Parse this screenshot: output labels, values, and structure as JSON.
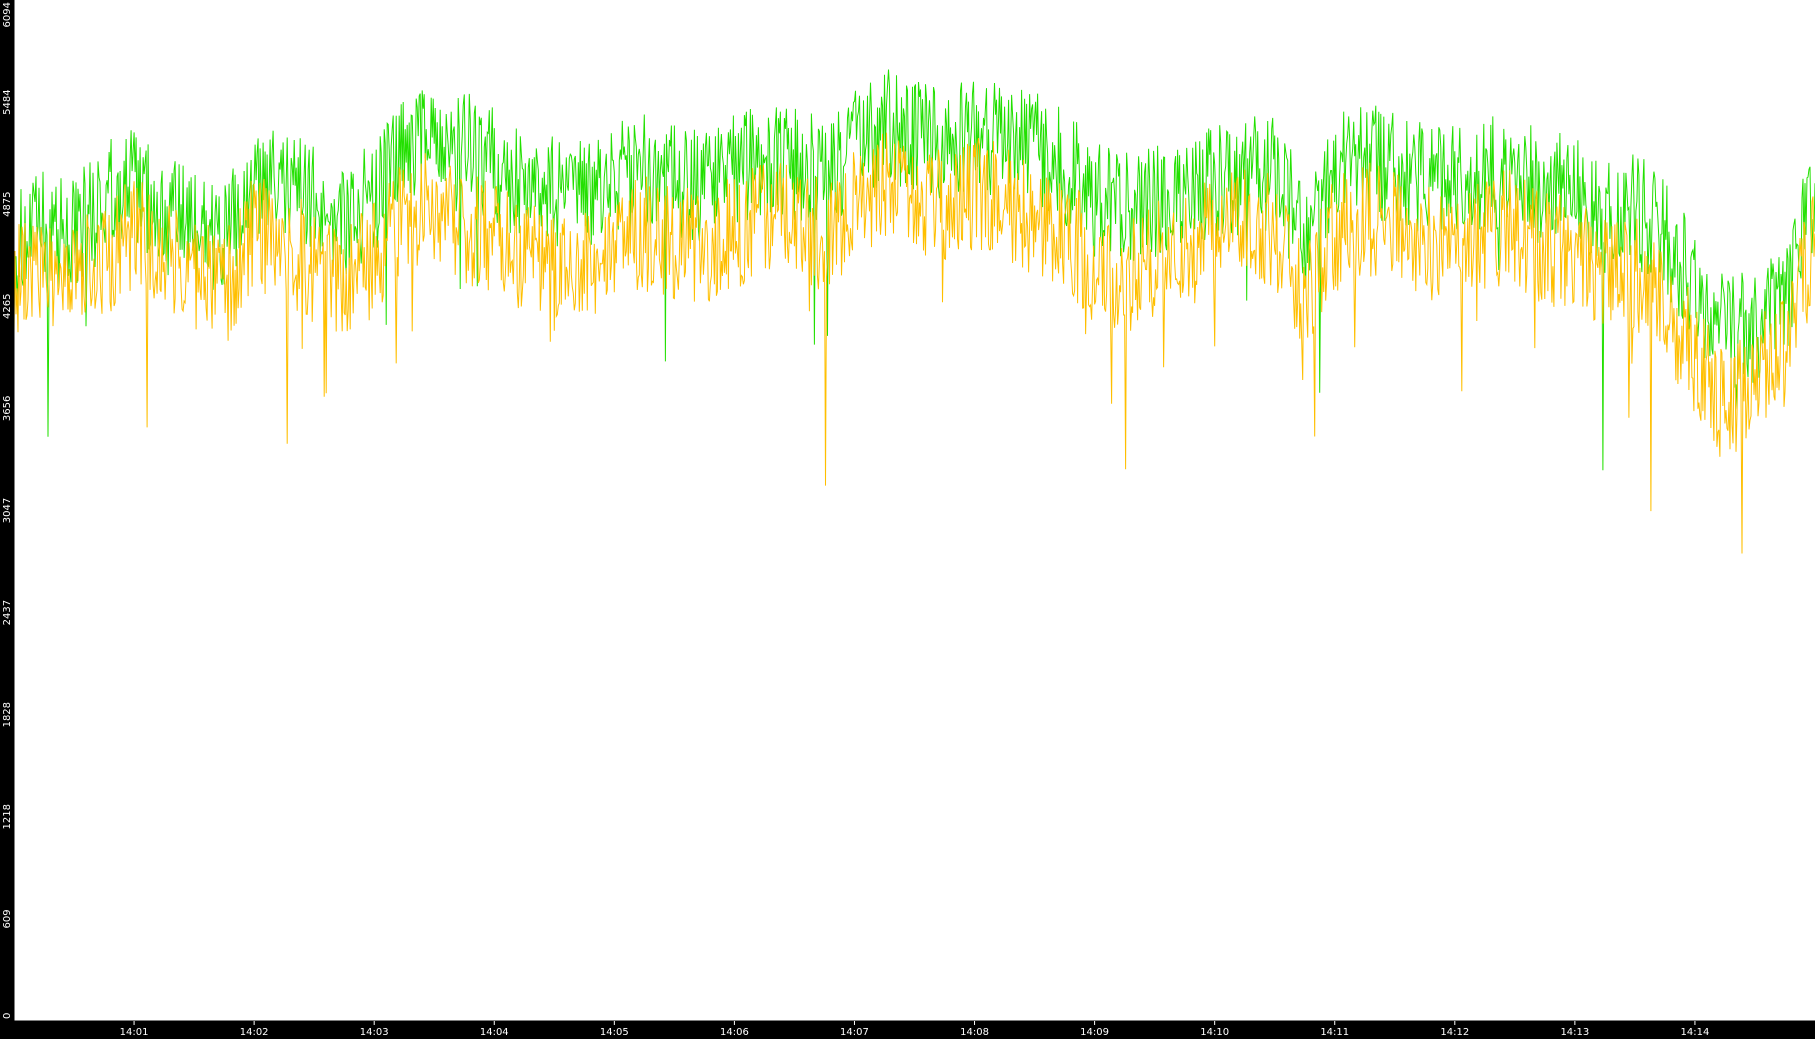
{
  "chart_data": {
    "type": "line",
    "title": "",
    "xlabel": "",
    "ylabel": "",
    "background": "#ffffff",
    "frame_color": "#000000",
    "grid": false,
    "legend": "none",
    "ylim": [
      0,
      6094
    ],
    "y_ticks": [
      "0",
      "609",
      "1218",
      "1828",
      "2437",
      "3047",
      "3656",
      "4265",
      "4875",
      "5484",
      "6094"
    ],
    "x_time_range": [
      "14:00:00",
      "14:15:00"
    ],
    "x_ticks": [
      "14:01",
      "14:02",
      "14:03",
      "14:04",
      "14:05",
      "14:06",
      "14:07",
      "14:08",
      "14:09",
      "14:10",
      "14:11",
      "14:12",
      "14:13",
      "14:14"
    ],
    "series": [
      {
        "color": "#22e000",
        "x": [
          "14:00:00",
          "14:00:15",
          "14:00:30",
          "14:00:45",
          "14:01:00",
          "14:01:15",
          "14:01:30",
          "14:01:45",
          "14:02:00",
          "14:02:15",
          "14:02:30",
          "14:02:45",
          "14:03:00",
          "14:03:15",
          "14:03:30",
          "14:03:45",
          "14:04:00",
          "14:04:15",
          "14:04:30",
          "14:04:45",
          "14:05:00",
          "14:05:15",
          "14:05:30",
          "14:05:45",
          "14:06:00",
          "14:06:15",
          "14:06:30",
          "14:06:45",
          "14:07:00",
          "14:07:15",
          "14:07:30",
          "14:07:45",
          "14:08:00",
          "14:08:15",
          "14:08:30",
          "14:08:45",
          "14:09:00",
          "14:09:15",
          "14:09:30",
          "14:09:45",
          "14:10:00",
          "14:10:15",
          "14:10:30",
          "14:10:45",
          "14:11:00",
          "14:11:15",
          "14:11:30",
          "14:11:45",
          "14:12:00",
          "14:12:15",
          "14:12:30",
          "14:12:45",
          "14:13:00",
          "14:13:15",
          "14:13:30",
          "14:13:45",
          "14:14:00",
          "14:14:15",
          "14:14:30",
          "14:14:45",
          "14:15:00"
        ],
        "values": [
          4600,
          4750,
          4700,
          4900,
          5000,
          4800,
          4750,
          4650,
          4950,
          5000,
          4900,
          4800,
          4900,
          5200,
          5300,
          5250,
          5100,
          5000,
          4950,
          4900,
          5050,
          5100,
          5000,
          5000,
          5100,
          5150,
          5100,
          5050,
          5200,
          5350,
          5300,
          5250,
          5300,
          5250,
          5200,
          5100,
          4900,
          4850,
          4900,
          4950,
          5000,
          5050,
          5050,
          4700,
          5050,
          5150,
          5100,
          5000,
          5000,
          5050,
          5100,
          4950,
          4950,
          4800,
          4850,
          4700,
          4350,
          4100,
          4150,
          4250,
          5000
        ]
      },
      {
        "color": "#ffbf00",
        "x": [
          "14:00:00",
          "14:00:15",
          "14:00:30",
          "14:00:45",
          "14:01:00",
          "14:01:15",
          "14:01:30",
          "14:01:45",
          "14:02:00",
          "14:02:15",
          "14:02:30",
          "14:02:45",
          "14:03:00",
          "14:03:15",
          "14:03:30",
          "14:03:45",
          "14:04:00",
          "14:04:15",
          "14:04:30",
          "14:04:45",
          "14:05:00",
          "14:05:15",
          "14:05:30",
          "14:05:45",
          "14:06:00",
          "14:06:15",
          "14:06:30",
          "14:06:45",
          "14:07:00",
          "14:07:15",
          "14:07:30",
          "14:07:45",
          "14:08:00",
          "14:08:15",
          "14:08:30",
          "14:08:45",
          "14:09:00",
          "14:09:15",
          "14:09:30",
          "14:09:45",
          "14:10:00",
          "14:10:15",
          "14:10:30",
          "14:10:45",
          "14:11:00",
          "14:11:15",
          "14:11:30",
          "14:11:45",
          "14:12:00",
          "14:12:15",
          "14:12:30",
          "14:12:45",
          "14:13:00",
          "14:13:15",
          "14:13:30",
          "14:13:45",
          "14:14:00",
          "14:14:15",
          "14:14:30",
          "14:14:45",
          "14:15:00"
        ],
        "values": [
          4450,
          4500,
          4400,
          4550,
          4700,
          4600,
          4450,
          4350,
          4700,
          4650,
          4500,
          4400,
          4550,
          4800,
          4850,
          4750,
          4650,
          4550,
          4450,
          4500,
          4650,
          4700,
          4650,
          4600,
          4700,
          4800,
          4750,
          4700,
          4850,
          5000,
          4950,
          4850,
          4950,
          4900,
          4800,
          4700,
          4500,
          4450,
          4550,
          4600,
          4700,
          4750,
          4700,
          4300,
          4700,
          4800,
          4750,
          4650,
          4650,
          4700,
          4750,
          4600,
          4600,
          4450,
          4450,
          4300,
          3950,
          3650,
          3900,
          4000,
          4700
        ]
      }
    ]
  }
}
